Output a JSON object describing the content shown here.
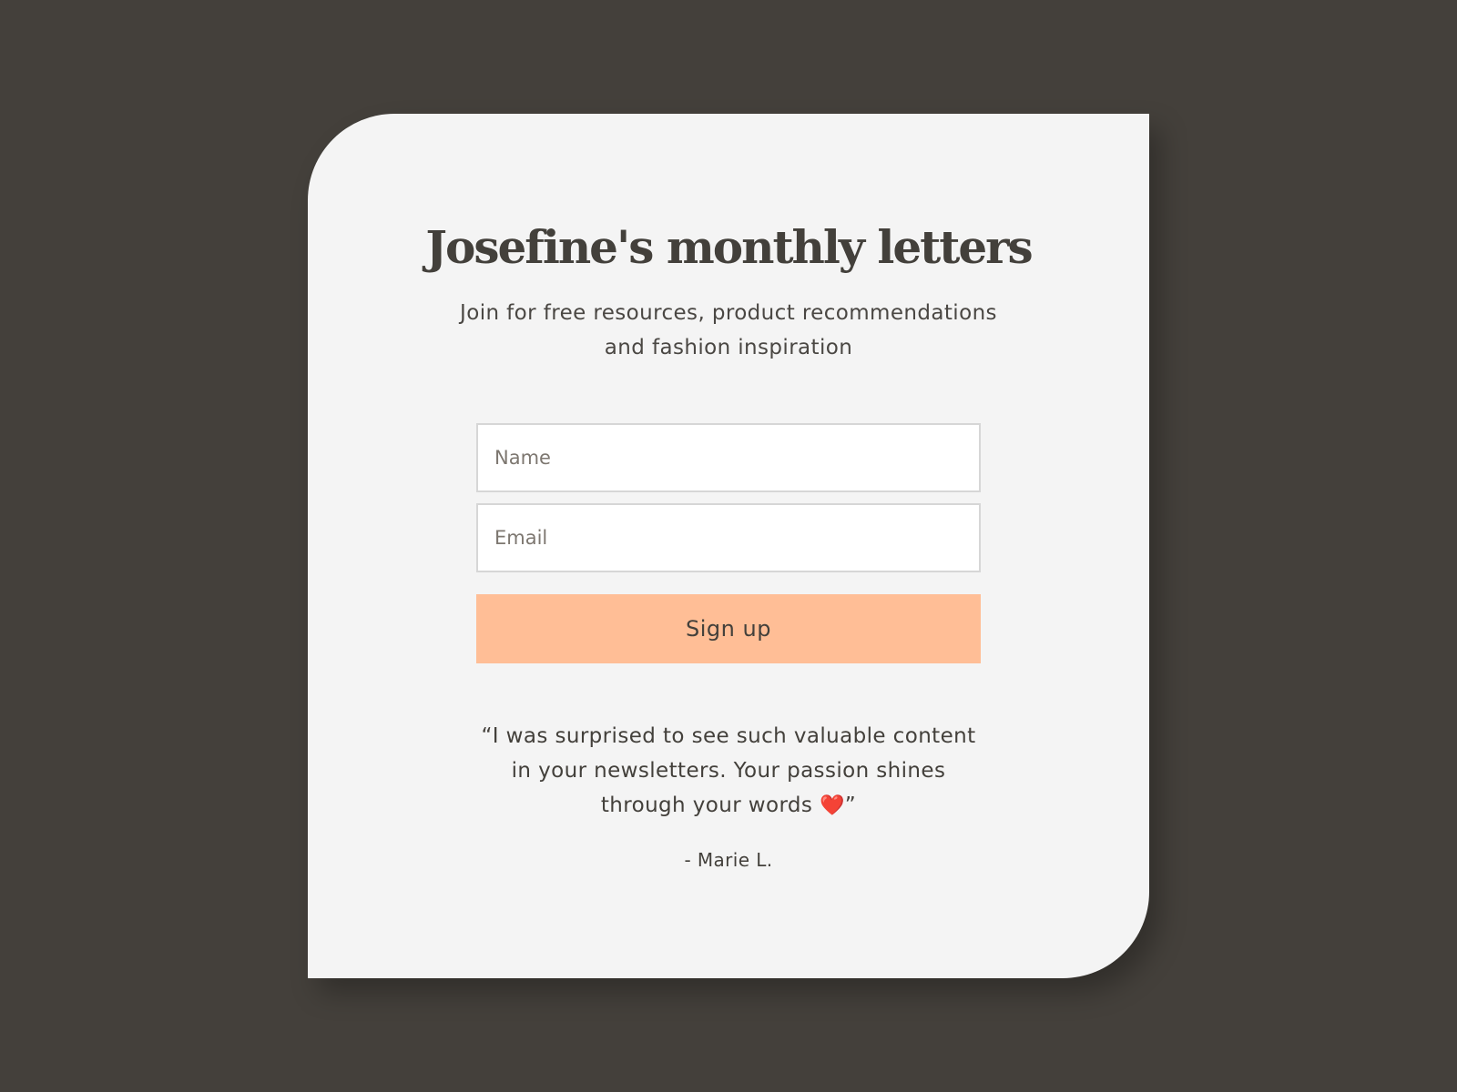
{
  "colors": {
    "background": "#44403b",
    "card": "#f4f4f4",
    "text": "#43403b",
    "accent_button": "#ffbe96",
    "heart": "#e2231a"
  },
  "card": {
    "title": "Josefine's monthly letters",
    "subtitle": "Join for free resources, product recommendations and fashion inspiration"
  },
  "form": {
    "name_placeholder": "Name",
    "email_placeholder": "Email",
    "signup_label": "Sign up"
  },
  "testimonial": {
    "quote_text": "“I was surprised to see such valuable content in your newsletters. Your passion shines through your words ",
    "heart_icon": "heart-icon",
    "heart_glyph": "❤️",
    "quote_close": "”",
    "author": "- Marie L."
  }
}
